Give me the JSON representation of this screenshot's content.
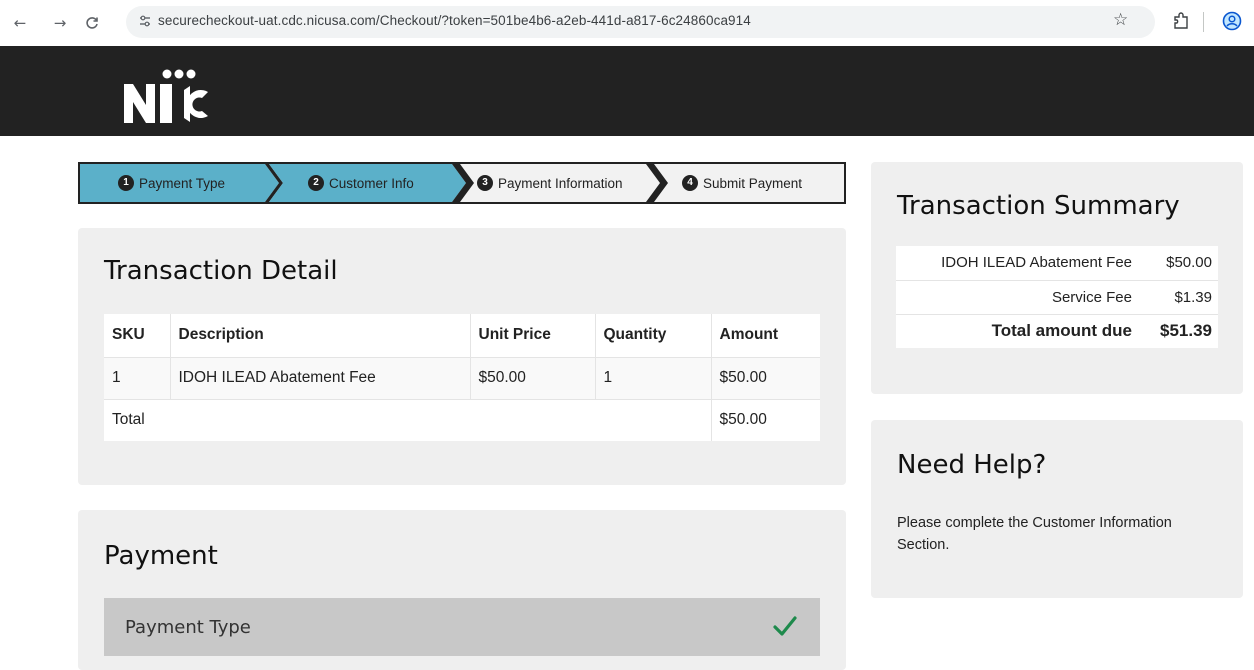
{
  "browser": {
    "url": "securecheckout-uat.cdc.nicusa.com/Checkout/?token=501be4b6-a2eb-441d-a817-6c24860ca914",
    "back_icon": "arrow-left-icon",
    "forward_icon": "arrow-right-icon",
    "reload_icon": "reload-icon"
  },
  "header": {
    "logo_text": "NIC",
    "background": "#222222"
  },
  "steps": [
    {
      "num": "1",
      "label": "Payment Type",
      "state": "complete",
      "color": "#5bb0c9"
    },
    {
      "num": "2",
      "label": "Customer Info",
      "state": "current",
      "color": "#5bb0c9"
    },
    {
      "num": "3",
      "label": "Payment Information",
      "state": "pending",
      "color": "#f2f2f2"
    },
    {
      "num": "4",
      "label": "Submit Payment",
      "state": "pending",
      "color": "#f2f2f2"
    }
  ],
  "transaction_detail": {
    "title": "Transaction Detail",
    "columns": [
      "SKU",
      "Description",
      "Unit Price",
      "Quantity",
      "Amount"
    ],
    "rows": [
      {
        "sku": "1",
        "description": "IDOH ILEAD Abatement Fee",
        "unit_price": "$50.00",
        "quantity": "1",
        "amount": "$50.00"
      }
    ],
    "total_label": "Total",
    "total_amount": "$50.00"
  },
  "payment": {
    "title": "Payment",
    "payment_type_label": "Payment Type",
    "check_color": "#1e8a4c"
  },
  "summary": {
    "title": "Transaction Summary",
    "items": [
      {
        "label": "IDOH ILEAD Abatement Fee",
        "value": "$50.00"
      },
      {
        "label": "Service Fee",
        "value": "$1.39"
      }
    ],
    "total_label": "Total amount due",
    "total_value": "$51.39"
  },
  "help": {
    "title": "Need Help?",
    "text": "Please complete the Customer Information Section."
  }
}
